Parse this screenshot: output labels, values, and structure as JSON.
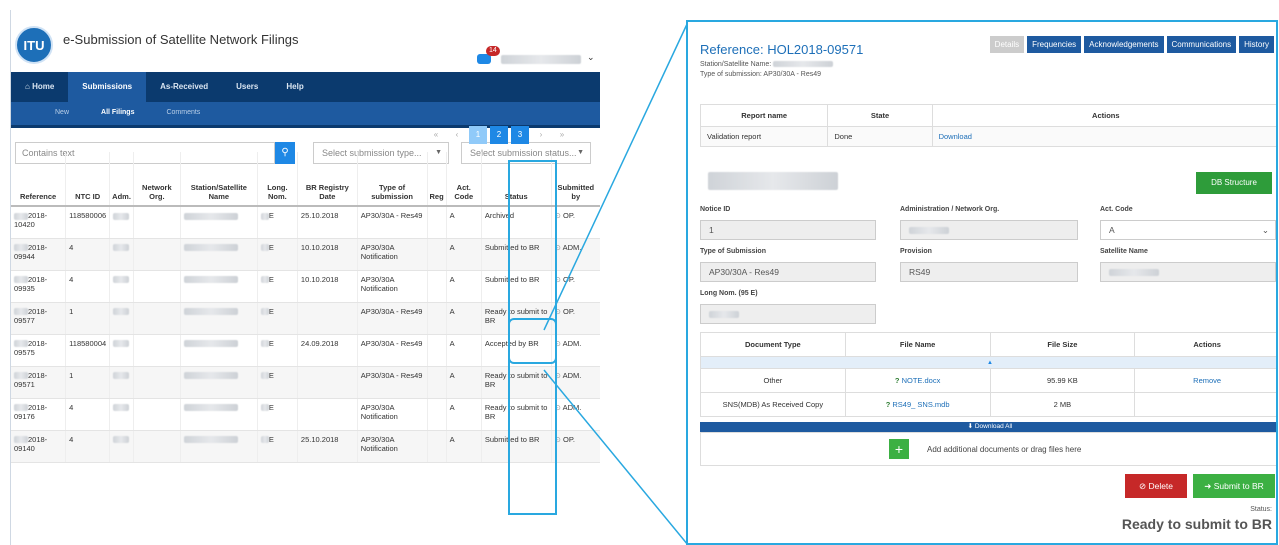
{
  "app": {
    "title": "e-Submission of Satellite Network Filings",
    "logo": "ITU",
    "notification_count": "14"
  },
  "nav": {
    "items": [
      "Home",
      "Submissions",
      "As-Received",
      "Users",
      "Help"
    ]
  },
  "subnav": {
    "items": [
      "New",
      "All Filings",
      "Comments"
    ]
  },
  "filters": {
    "search_placeholder": "Contains text",
    "type_placeholder": "Select submission type...",
    "status_placeholder": "Select submission status..."
  },
  "pager": {
    "first": "«",
    "prev": "‹",
    "pages": [
      "1",
      "2",
      "3"
    ],
    "next": "›",
    "last": "»"
  },
  "table": {
    "headers": [
      "Reference",
      "NTC ID",
      "Adm.",
      "Network Org.",
      "Station/Satellite Name",
      "Long. Nom.",
      "BR Registry Date",
      "Type of submission",
      "Reg",
      "Act. Code",
      "Status",
      "Submitted by"
    ],
    "rows": [
      {
        "ref": "2018-10420",
        "ntc": "118580006",
        "long": "E",
        "date": "25.10.2018",
        "type": "AP30/30A - Res49",
        "code": "A",
        "status": "Archived",
        "by": "OP."
      },
      {
        "ref": "2018-09944",
        "ntc": "4",
        "long": "E",
        "date": "10.10.2018",
        "type": "AP30/30A Notification",
        "code": "A",
        "status": "Submitted to BR",
        "by": "ADM."
      },
      {
        "ref": "2018-09935",
        "ntc": "4",
        "long": "E",
        "date": "10.10.2018",
        "type": "AP30/30A Notification",
        "code": "A",
        "status": "Submitted to BR",
        "by": "OP."
      },
      {
        "ref": "2018-09577",
        "ntc": "1",
        "long": "E",
        "date": "",
        "type": "AP30/30A - Res49",
        "code": "A",
        "status": "Ready to submit to BR",
        "by": "OP."
      },
      {
        "ref": "2018-09575",
        "ntc": "118580004",
        "long": "E",
        "date": "24.09.2018",
        "type": "AP30/30A - Res49",
        "code": "A",
        "status": "Accepted by BR",
        "by": "ADM."
      },
      {
        "ref": "2018-09571",
        "ntc": "1",
        "long": "E",
        "date": "",
        "type": "AP30/30A - Res49",
        "code": "A",
        "status": "Ready to submit to BR",
        "by": "ADM."
      },
      {
        "ref": "2018-09176",
        "ntc": "4",
        "long": "E",
        "date": "",
        "type": "AP30/30A Notification",
        "code": "A",
        "status": "Ready to submit to BR",
        "by": "ADM."
      },
      {
        "ref": "2018-09140",
        "ntc": "4",
        "long": "E",
        "date": "25.10.2018",
        "type": "AP30/30A Notification",
        "code": "A",
        "status": "Submitted to BR",
        "by": "OP."
      }
    ]
  },
  "detail": {
    "reference": "Reference: HOL2018-09571",
    "station_label": "Station/Satellite Name:",
    "type_line": "Type of submission: AP30/30A - Res49",
    "tabs": [
      "Details",
      "Frequencies",
      "Acknowledgements",
      "Communications",
      "History"
    ],
    "report": {
      "headers": [
        "Report name",
        "State",
        "Actions"
      ],
      "row": {
        "name": "Validation report",
        "state": "Done",
        "action": "Download"
      }
    },
    "db_button": "DB Structure",
    "fields": {
      "notice_id_label": "Notice ID",
      "notice_id": "1",
      "admin_label": "Administration / Network Org.",
      "act_code_label": "Act. Code",
      "act_code": "A",
      "type_label": "Type of Submission",
      "type": "AP30/30A - Res49",
      "provision_label": "Provision",
      "provision": "RS49",
      "sat_name_label": "Satellite Name",
      "long_label": "Long Nom. (95 E)"
    },
    "docs": {
      "headers": [
        "Document Type",
        "File Name",
        "File Size",
        "Actions"
      ],
      "rows": [
        {
          "type": "Other",
          "prefix": "? ",
          "file": "NOTE.docx",
          "size": "95.99 KB",
          "action": "Remove"
        },
        {
          "type": "SNS(MDB) As Received Copy",
          "prefix": "? ",
          "file": "RS49_ SNS.mdb",
          "size": "2 MB",
          "action": ""
        }
      ],
      "collapse": "▲",
      "download_all": "⬇ Download All",
      "add_text": "Add additional documents or drag files here",
      "add_symbol": "+"
    },
    "delete_label": "Delete",
    "submit_label": "Submit to BR",
    "status_label": "Status:",
    "status_value": "Ready to submit to BR"
  }
}
